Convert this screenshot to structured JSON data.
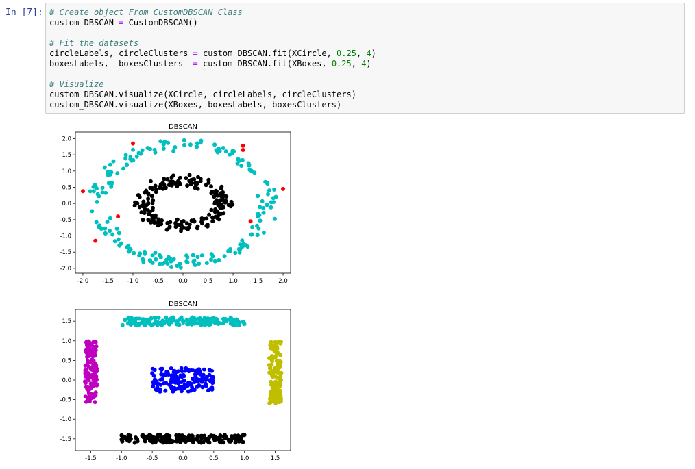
{
  "prompt": "In [7]:",
  "code_lines": [
    {
      "comment": "# Create object From CustomDBSCAN Class"
    },
    {
      "parts": [
        [
          "custom_DBSCAN "
        ],
        [
          "=",
          "o"
        ],
        [
          " CustomDBSCAN()"
        ]
      ]
    },
    {
      "blank": true
    },
    {
      "comment": "# Fit the datasets"
    },
    {
      "parts": [
        [
          "circleLabels, circleClusters "
        ],
        [
          "=",
          "o"
        ],
        [
          " custom_DBSCAN.fit(XCircle, "
        ],
        [
          "0.25",
          "n"
        ],
        [
          ", "
        ],
        [
          "4",
          "n"
        ],
        [
          ")"
        ]
      ]
    },
    {
      "parts": [
        [
          "boxesLabels,  boxesClusters  "
        ],
        [
          "=",
          "o"
        ],
        [
          " custom_DBSCAN.fit(XBoxes, "
        ],
        [
          "0.25",
          "n"
        ],
        [
          ", "
        ],
        [
          "4",
          "n"
        ],
        [
          ")"
        ]
      ]
    },
    {
      "blank": true
    },
    {
      "comment": "# Visualize"
    },
    {
      "parts": [
        [
          "custom_DBSCAN.visualize(XCircle, circleLabels, circleClusters)"
        ]
      ]
    },
    {
      "parts": [
        [
          "custom_DBSCAN.visualize(XBoxes, boxesLabels, boxesClusters)"
        ]
      ]
    }
  ],
  "colors": {
    "cyan": "#00bfbf",
    "black": "#000000",
    "red": "#ff0000",
    "blue": "#0000ff",
    "magenta": "#bf00bf",
    "yellow": "#bfbf00"
  },
  "chart_data": [
    {
      "type": "scatter",
      "title": "DBSCAN",
      "xlim": [
        -2.15,
        2.15
      ],
      "ylim": [
        -2.15,
        2.2
      ],
      "xticks": [
        "-2.0",
        "-1.5",
        "-1.0",
        "-0.5",
        "0.0",
        "0.5",
        "1.0",
        "1.5",
        "2.0"
      ],
      "yticks": [
        "2.0",
        "1.5",
        "1.0",
        "0.5",
        "0.0",
        "-0.5",
        "-1.0",
        "-1.5",
        "-2.0"
      ],
      "grid": false,
      "series": [
        {
          "color": "#00bfbf",
          "shape": "ring",
          "center": [
            0,
            0
          ],
          "radius_x": [
            1.5,
            1.9
          ],
          "radius_y": [
            1.6,
            2.0
          ],
          "count": 200
        },
        {
          "color": "#000000",
          "shape": "ring",
          "center": [
            0,
            0
          ],
          "radius_x": [
            0.6,
            1.0
          ],
          "radius_y": [
            0.5,
            0.9
          ],
          "count": 200
        },
        {
          "color": "#ff0000",
          "shape": "points",
          "points": [
            [
              -1.0,
              1.85
            ],
            [
              1.2,
              1.78
            ],
            [
              1.2,
              1.65
            ],
            [
              -2.0,
              0.38
            ],
            [
              2.0,
              0.45
            ],
            [
              -1.3,
              -0.4
            ],
            [
              1.35,
              -0.55
            ],
            [
              -1.75,
              -1.15
            ]
          ]
        }
      ]
    },
    {
      "type": "scatter",
      "title": "DBSCAN",
      "xlim": [
        -1.75,
        1.75
      ],
      "ylim": [
        -1.8,
        1.8
      ],
      "xticks": [
        "-1.5",
        "-1.0",
        "-0.5",
        "0.0",
        "0.5",
        "1.0",
        "1.5"
      ],
      "yticks": [
        "1.5",
        "1.0",
        "0.5",
        "0.0",
        "-0.5",
        "-1.0",
        "-1.5"
      ],
      "grid": false,
      "series": [
        {
          "color": "#00bfbf",
          "shape": "rect",
          "x": [
            -1.0,
            1.0
          ],
          "y": [
            1.4,
            1.6
          ],
          "count": 180
        },
        {
          "color": "#bf00bf",
          "shape": "rect",
          "x": [
            -1.6,
            -1.4
          ],
          "y": [
            -0.6,
            1.0
          ],
          "count": 140
        },
        {
          "color": "#0000ff",
          "shape": "rect",
          "x": [
            -0.5,
            0.5
          ],
          "y": [
            -0.3,
            0.3
          ],
          "count": 140
        },
        {
          "color": "#bfbf00",
          "shape": "rect",
          "x": [
            1.4,
            1.6
          ],
          "y": [
            -0.6,
            1.0
          ],
          "count": 140
        },
        {
          "color": "#000000",
          "shape": "rect",
          "x": [
            -1.0,
            1.0
          ],
          "y": [
            -1.6,
            -1.4
          ],
          "count": 180
        }
      ]
    }
  ]
}
